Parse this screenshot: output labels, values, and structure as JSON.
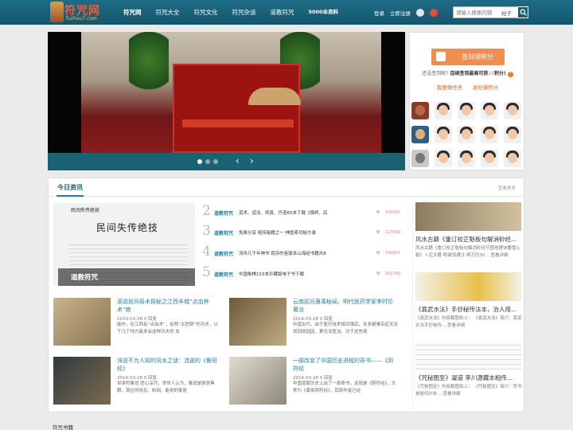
{
  "header": {
    "logo_text": "符咒网",
    "logo_url": "fuzhou7.com",
    "nav": [
      "符咒网",
      "符咒大全",
      "符咒文化",
      "符咒杂谈",
      "道教符咒",
      "5000本资料"
    ],
    "login": "登录",
    "register": "立即注册",
    "search_placeholder": "请输入搜索内容",
    "search_type": "帖子"
  },
  "signin": {
    "button": "签到领积分",
    "line1": "还没签到呢? ",
    "line2": "连续签到最高可获",
    "line3": "积分!",
    "points": "10",
    "link1": "我要做任务",
    "link2": "发帖赚积分"
  },
  "news": {
    "title": "今日资讯",
    "more": "查看更多",
    "feature": {
      "doc_header": "民间失传绝技",
      "doc_big": "民间失传绝技",
      "caption": "道教符咒"
    },
    "ranks": [
      {
        "n": "2",
        "cat": "道教符咒",
        "title": "道术、道法、修真、丹道65本下载《慎终，后",
        "count": "100062"
      },
      {
        "n": "3",
        "cat": "道教符咒",
        "title": "免费分享 祖传秘籍之一 神医奇功秘方录",
        "count": "127050"
      },
      {
        "n": "4",
        "cat": "道教符咒",
        "title": "流传几千年神书 现存的各版本山海经书籍共8",
        "count": "140057"
      },
      {
        "n": "5",
        "cat": "道教符咒",
        "title": "中国象棋153本珍藏版电子书下载",
        "count": "162760"
      }
    ],
    "articles": [
      {
        "title": "滚说民间奇术探秘之江西丰城“点血养术”绝",
        "date": "2014-03-28 0 回复",
        "excerpt": "能作，在江西有“点血术”，俗称“五把铜”的功夫，以下几个地方最多会这种功夫的 本"
      },
      {
        "title": "云南民间蛊毒秘闻，明代医药学家李时珍著治",
        "date": "2014-03-28 0 回复",
        "excerpt": "中国古代，由于医疗技术相对落后，许多疑难杂症无法找到原因因，更无法医治。对于这些病"
      },
      {
        "title": "浅说不为人知的风水之谜：流逝的《鲁班经》",
        "date": "2014-03-28 0 回复",
        "excerpt": "世承符鲁班 匠心深月，世世人认为，鲁班是家居典籍，现在所规见、盼闻、能用的家居"
      },
      {
        "title": "一部改变了中国历史进程的奇书——《阴符经",
        "date": "2014-03-28 0 回复",
        "excerpt": "中国道家历史上出了一部奇书，这就是《阴符经》，文称为《黄帝阴符经》，其原作者已经"
      }
    ],
    "side": [
      {
        "title": "风水古籍《重订校正魁板句解消砂经...",
        "desc": "风水古籍《重订校正魁板句解消砂经节图地理诀要雪心赋》卜应天著 明谢流通注 明万历30 ...查看详细"
      },
      {
        "title": "《真武水法》手抄秘传法本，治人用...",
        "desc": "《真武水法》内容截图如上： 《真武水法》简介：真武水法手抄秘传 ...查看详细"
      },
      {
        "title": "《咒秘图至》凝道 李川源藏本相传...",
        "desc": "《咒秘图至》内容截图如上： 《咒秘图至》简介：符书是秘传抄本 ...查看详细"
      }
    ]
  },
  "section2_title": "符咒书籍",
  "colors": {
    "nav_bg": "#1b6580",
    "accent": "#1d7f9d",
    "orange": "#ef8f4f",
    "count": "#e27b70"
  }
}
